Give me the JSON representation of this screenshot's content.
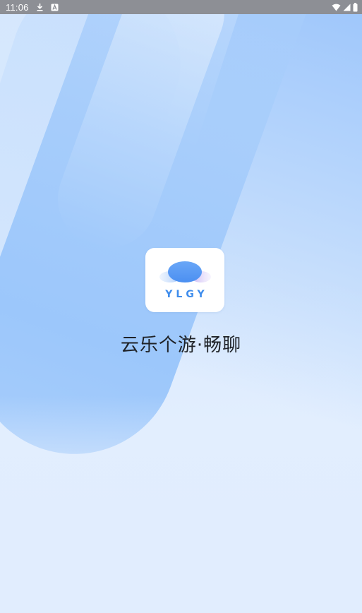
{
  "status_bar": {
    "time": "11:06",
    "icons": [
      "download-icon",
      "notification-app-icon",
      "wifi-icon",
      "signal-icon",
      "battery-icon"
    ]
  },
  "splash": {
    "logo_text": "YLGY",
    "app_name": "云乐个游·畅聊"
  },
  "colors": {
    "status_bar_bg": "#8d8f95",
    "logo_accent": "#3f8dec",
    "background": "#dbeafd",
    "title_text": "#1f2227"
  }
}
